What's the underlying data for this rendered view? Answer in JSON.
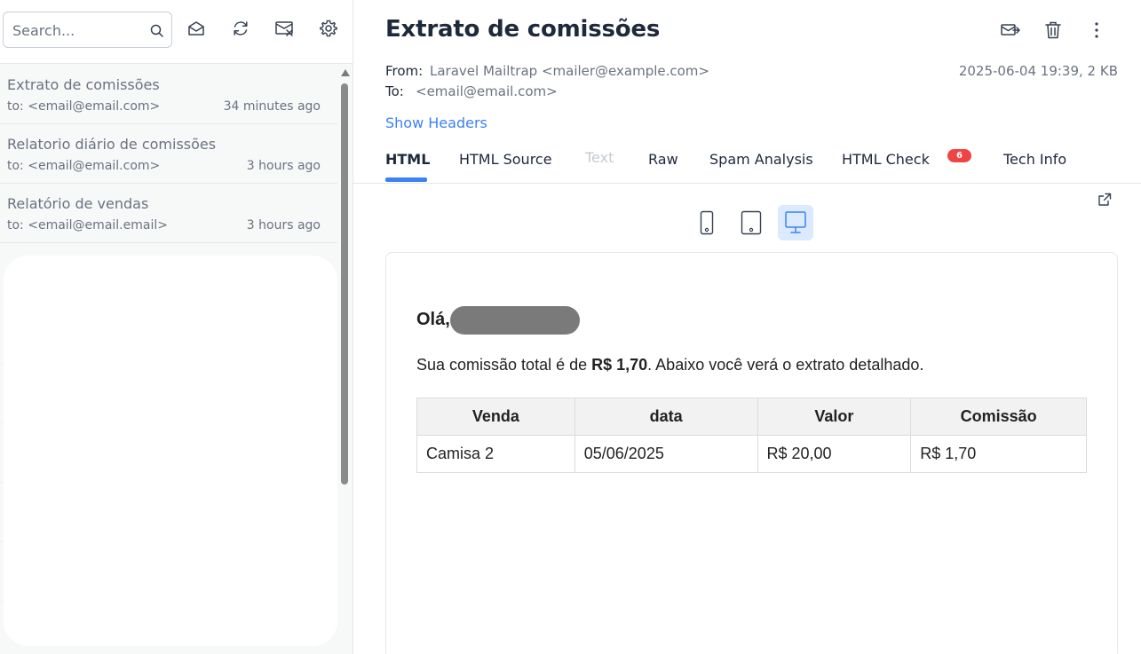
{
  "sidebar": {
    "search_placeholder": "Search...",
    "toolbar_icons": [
      "mark-read-icon",
      "refresh-icon",
      "delete-all-icon",
      "settings-icon"
    ],
    "messages": [
      {
        "subject": "Extrato de comissões",
        "to": "to: <email@email.com>",
        "time": "34 minutes ago"
      },
      {
        "subject": "Relatorio diário de comissões",
        "to": "to: <email@email.com>",
        "time": "3 hours ago"
      },
      {
        "subject": "Relatório de vendas",
        "to": "to: <email@email.email>",
        "time": "3 hours ago"
      }
    ]
  },
  "message": {
    "title": "Extrato de comissões",
    "from_label": "From:",
    "from_value": "Laravel Mailtrap <mailer@example.com>",
    "to_label": "To:",
    "to_value": "<email@email.com>",
    "meta": "2025-06-04 19:39, 2 KB",
    "show_headers": "Show Headers",
    "tabs": [
      "HTML",
      "HTML Source",
      "Text",
      "Raw",
      "Spam Analysis",
      "HTML Check",
      "Tech Info"
    ],
    "html_check_badge": "6",
    "accent_color": "#3b82f6",
    "badge_color": "#ef4444"
  },
  "email_body": {
    "greeting": "Olá,",
    "intro_before": "Sua comissão total é de ",
    "intro_amount": "R$ 1,70",
    "intro_after": ". Abaixo você verá o extrato detalhado.",
    "table_headers": [
      "Venda",
      "data",
      "Valor",
      "Comissão"
    ],
    "table_rows": [
      [
        "Camisa 2",
        "05/06/2025",
        "R$ 20,00",
        "R$ 1,70"
      ]
    ]
  }
}
